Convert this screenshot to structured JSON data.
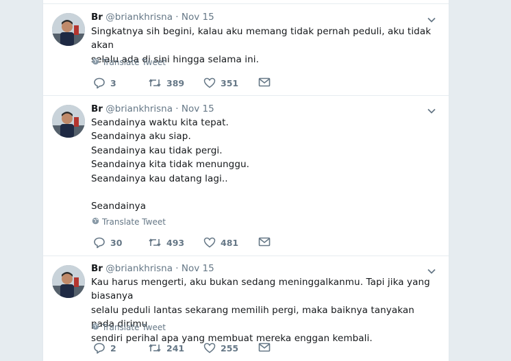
{
  "tweets": [
    {
      "author_name": "Br",
      "handle": "@briankhrisna",
      "separator": "·",
      "date": "Nov 15",
      "lines": [
        "Singkatnya sih begini, kalau aku memang tidak pernah peduli, aku tidak akan",
        "selalu ada di sini hingga selama ini."
      ],
      "translate_label": "Translate Tweet",
      "replies": "3",
      "retweets": "389",
      "likes": "351"
    },
    {
      "author_name": "Br",
      "handle": "@briankhrisna",
      "separator": "·",
      "date": "Nov 15",
      "lines": [
        "Seandainya waktu kita tepat.",
        "Seandainya aku siap.",
        "Seandainya kau tidak pergi.",
        "Seandainya kita tidak menunggu.",
        "Seandainya kau datang lagi..",
        "",
        "Seandainya"
      ],
      "translate_label": "Translate Tweet",
      "replies": "30",
      "retweets": "493",
      "likes": "481"
    },
    {
      "author_name": "Br",
      "handle": "@briankhrisna",
      "separator": "·",
      "date": "Nov 15",
      "lines": [
        "Kau harus mengerti, aku bukan sedang meninggalkanmu. Tapi jika yang biasanya",
        "selalu peduli lantas sekarang memilih pergi, maka baiknya tanyakan pada dirimu",
        "sendiri perihal apa yang membuat mereka enggan kembali."
      ],
      "translate_label": "Translate Tweet",
      "replies": "2",
      "retweets": "241",
      "likes": "255"
    }
  ],
  "icons": {
    "reply": "reply-icon",
    "retweet": "retweet-icon",
    "like": "heart-icon",
    "dm": "envelope-icon",
    "translate": "globe-icon",
    "caret": "chevron-down-icon"
  },
  "colors": {
    "background": "#e6ecf0",
    "card": "#ffffff",
    "text": "#14171a",
    "muted": "#657786"
  }
}
